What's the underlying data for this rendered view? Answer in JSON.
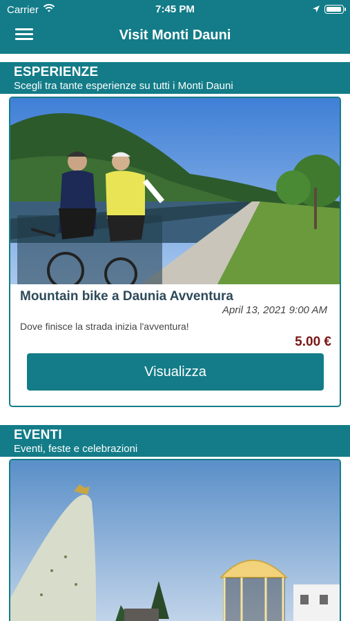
{
  "status_bar": {
    "carrier": "Carrier",
    "time": "7:45 PM"
  },
  "header": {
    "title": "Visit Monti Dauni"
  },
  "sections": [
    {
      "heading": "ESPERIENZE",
      "subheading": "Scegli tra tante esperienze su tutti i Monti Dauni",
      "card": {
        "image_alt": "mountain bikers on lakeside boardwalk",
        "title": "Mountain bike a Daunia Avventura",
        "date": "April 13, 2021 9:00 AM",
        "description": "Dove finisce la strada inizia l'avventura!",
        "price": "5.00 €",
        "button_label": "Visualizza"
      }
    },
    {
      "heading": "EVENTI",
      "subheading": "Eventi, feste e celebrazioni",
      "card": {
        "image_alt": "statue and illuminated bandstand"
      }
    }
  ],
  "colors": {
    "brand_teal": "#137c88",
    "price_red": "#7a1515"
  }
}
